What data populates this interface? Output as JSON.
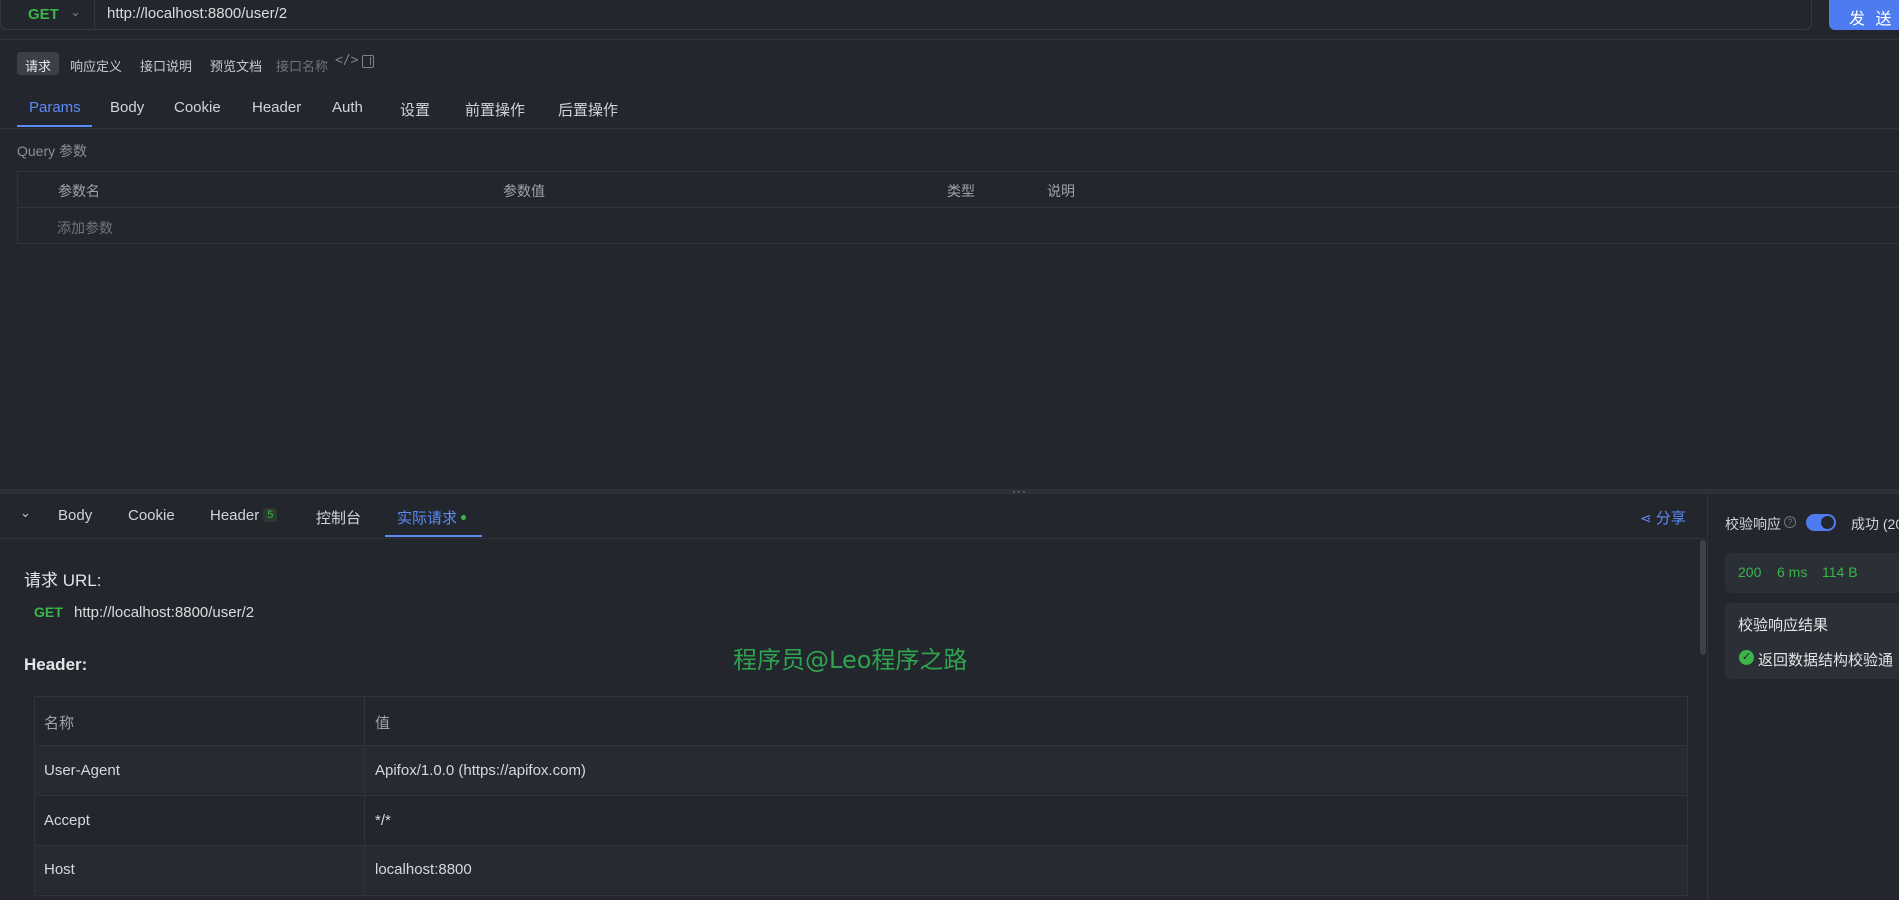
{
  "request_bar": {
    "method": "GET",
    "method_chevron": "⌄",
    "url": "http://localhost:8800/user/2",
    "send_label": "发 送"
  },
  "sub_toolbar": {
    "tabs": [
      "请求",
      "响应定义",
      "接口说明",
      "预览文档"
    ],
    "name_placeholder": "接口名称",
    "code_icon": "code-icon",
    "panel_icon": "panel-icon"
  },
  "params_tabs": [
    "Params",
    "Body",
    "Cookie",
    "Header",
    "Auth",
    "设置",
    "前置操作",
    "后置操作"
  ],
  "query": {
    "label": "Query 参数",
    "columns": [
      "参数名",
      "参数值",
      "类型",
      "说明"
    ],
    "add_placeholder": "添加参数"
  },
  "response_tabs": {
    "tabs": [
      "Body",
      "Cookie",
      "Header",
      "控制台",
      "实际请求"
    ],
    "header_count": "5",
    "share": "分享"
  },
  "actual_request": {
    "url_heading": "请求 URL:",
    "method": "GET",
    "url": "http://localhost:8800/user/2",
    "header_heading": "Header:",
    "watermark": "程序员@Leo程序之路",
    "table": {
      "columns": [
        "名称",
        "值"
      ],
      "rows": [
        {
          "name": "User-Agent",
          "value": "Apifox/1.0.0 (https://apifox.com)"
        },
        {
          "name": "Accept",
          "value": "*/*"
        },
        {
          "name": "Host",
          "value": "localhost:8800"
        }
      ]
    }
  },
  "right_panel": {
    "validate_label": "校验响应",
    "validate_enabled": true,
    "success_label": "成功 (20",
    "status": "200",
    "time": "6 ms",
    "size": "114 B",
    "result_title": "校验响应结果",
    "result_text": "返回数据结构校验通",
    "colors": {
      "accent": "#4e7cf0",
      "success": "#39b54a"
    }
  }
}
